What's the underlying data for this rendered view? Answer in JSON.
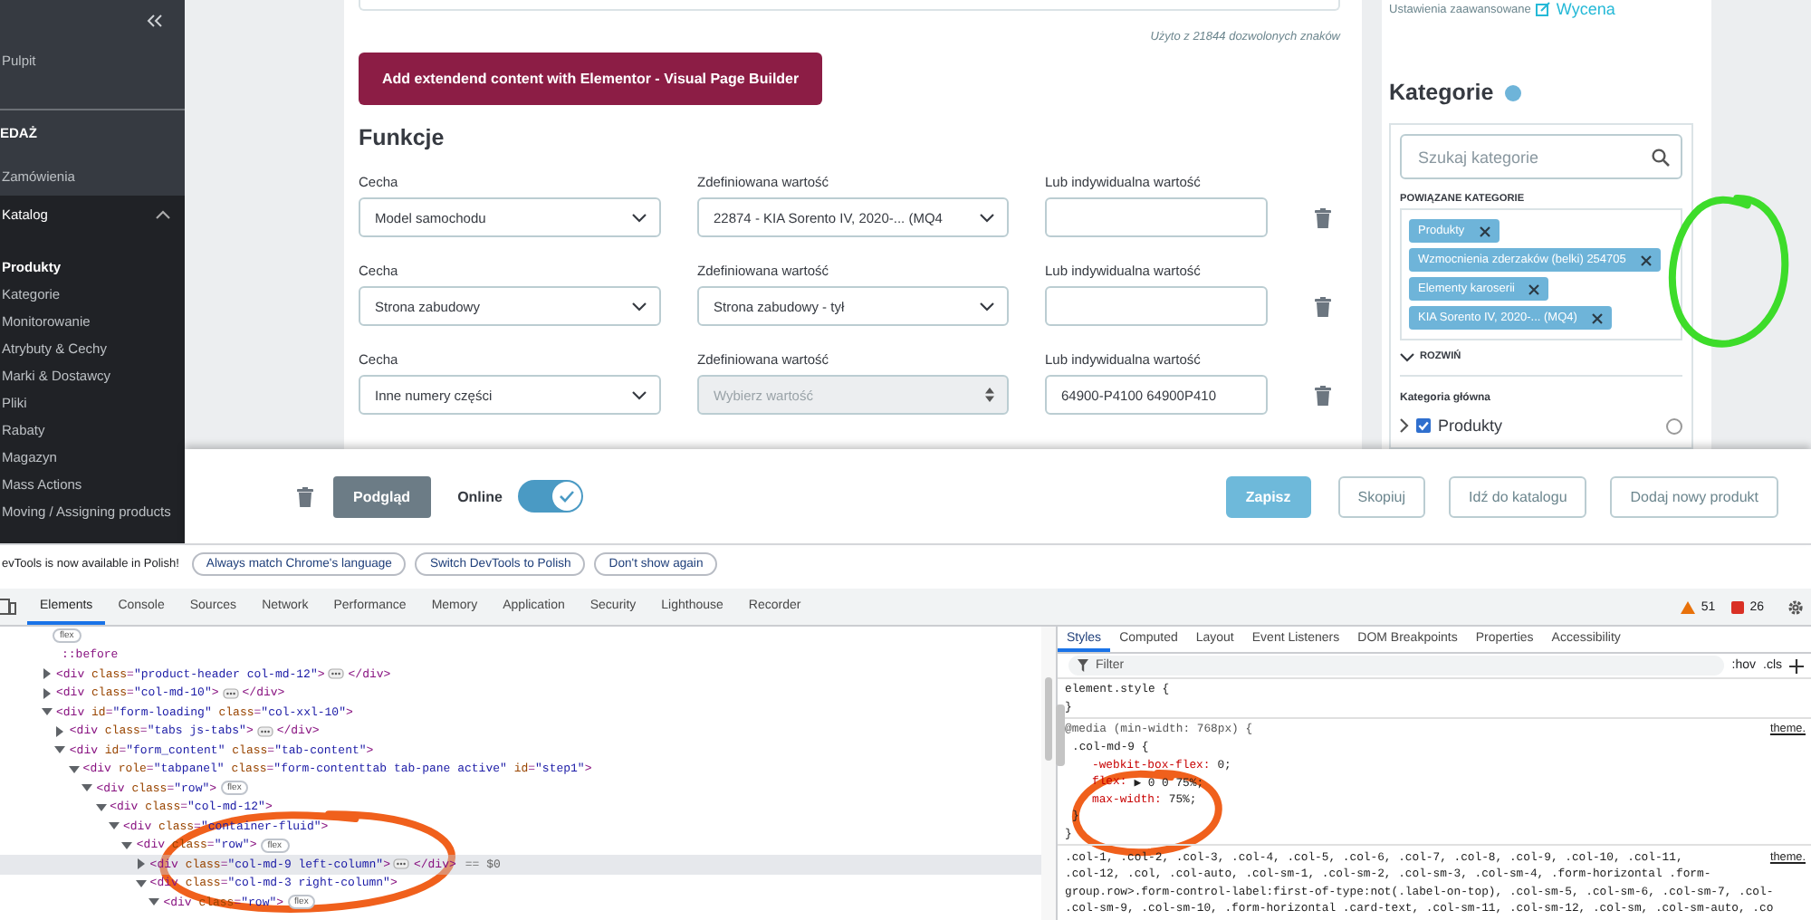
{
  "sidebar": {
    "items": [
      {
        "kind": "link",
        "label": "Pulpit"
      },
      {
        "kind": "section",
        "label": "EDAŻ"
      },
      {
        "kind": "link",
        "label": "Zamówienia"
      },
      {
        "kind": "group",
        "label": "Katalog",
        "expanded": true,
        "children": [
          {
            "label": "Produkty",
            "selected": true
          },
          {
            "label": "Kategorie",
            "selected": false
          },
          {
            "label": "Monitorowanie",
            "selected": false
          },
          {
            "label": "Atrybuty & Cechy",
            "selected": false
          },
          {
            "label": "Marki & Dostawcy",
            "selected": false
          },
          {
            "label": "Pliki",
            "selected": false
          },
          {
            "label": "Rabaty",
            "selected": false
          },
          {
            "label": "Magazyn",
            "selected": false
          },
          {
            "label": "Mass Actions",
            "selected": false
          },
          {
            "label": "Moving / Assigning products",
            "selected": false
          }
        ]
      }
    ]
  },
  "product_form": {
    "counter": "Użyto z 21844 dozwolonych znaków",
    "elementor_button": "Add extendend content with Elementor - Visual Page Builder",
    "features_title": "Funkcje",
    "features": [
      {
        "feature_label": "Cecha",
        "feature": "Model samochodu",
        "value_label": "Zdefiniowana wartość",
        "value": "22874 - KIA Sorento IV, 2020-... (MQ4",
        "value_disabled": false,
        "custom_label": "Lub indywidualna wartość"
      },
      {
        "feature_label": "Cecha",
        "feature": "Strona zabudowy",
        "value_label": "Zdefiniowana wartość",
        "value": "Strona zabudowy - tył",
        "value_disabled": false,
        "custom_label": "Lub indywidualna wartość"
      },
      {
        "feature_label": "Cecha",
        "feature": "Inne numery części",
        "value_label": "Zdefiniowana wartość",
        "value_placeholder": "Wybierz wartość",
        "value_disabled": true,
        "custom_label": "Lub indywidualna wartość",
        "custom": "64900-P4100 64900P410"
      }
    ]
  },
  "category_panel": {
    "advanced_label": "Ustawienia zaawansowane",
    "pricing_link": "Wycena",
    "title": "Kategorie",
    "search_placeholder": "Szukaj kategorie",
    "related_label": "POWIĄZANE KATEGORIE",
    "tags": [
      "Produkty",
      "Wzmocnienia zderzaków (belki) 254705",
      "Elementy karoserii",
      "KIA Sorento IV, 2020-... (MQ4)"
    ],
    "expand_label": "ROZWIŃ",
    "main_label": "Kategoria główna",
    "tree": [
      {
        "label": "Produkty",
        "expanded": false,
        "checked": true,
        "selected": false
      }
    ]
  },
  "action_bar": {
    "preview": "Podgląd",
    "online_label": "Online",
    "online": true,
    "buttons": [
      {
        "label": "Zapisz",
        "kind": "primary"
      },
      {
        "label": "Skopiuj",
        "kind": "outline"
      },
      {
        "label": "Idź do katalogu",
        "kind": "outline"
      },
      {
        "label": "Dodaj nowy produkt",
        "kind": "outline"
      }
    ]
  },
  "devtools": {
    "infobar": {
      "message": "evTools is now available in Polish!",
      "buttons": [
        "Always match Chrome's language",
        "Switch DevTools to Polish",
        "Don't show again"
      ]
    },
    "tabs": [
      {
        "label": "Elements",
        "selected": true
      },
      {
        "label": "Console",
        "selected": false
      },
      {
        "label": "Sources",
        "selected": false
      },
      {
        "label": "Network",
        "selected": false
      },
      {
        "label": "Performance",
        "selected": false
      },
      {
        "label": "Memory",
        "selected": false
      },
      {
        "label": "Application",
        "selected": false
      },
      {
        "label": "Security",
        "selected": false
      },
      {
        "label": "Lighthouse",
        "selected": false
      },
      {
        "label": "Recorder",
        "selected": false
      }
    ],
    "warnings": "51",
    "errors": "26",
    "dom": [
      {
        "kind": "badge",
        "badge": "flex"
      },
      {
        "kind": "pseudo",
        "tag": "::before"
      },
      {
        "kind": "element",
        "tag": "<div class=\"product-header col-md-12\">",
        "tail": "</div>",
        "expanded": false,
        "selected": false
      },
      {
        "kind": "element",
        "tag": "<div class=\"col-md-10\">",
        "tail": "</div>",
        "expanded": false,
        "selected": false
      },
      {
        "kind": "element",
        "tag": "<div id=\"form-loading\" class=\"col-xxl-10\">",
        "expanded": true,
        "selected": false,
        "children": [
          {
            "kind": "element",
            "tag": "<div class=\"tabs js-tabs\">",
            "tail": "</div>",
            "expanded": false,
            "selected": false
          },
          {
            "kind": "element",
            "tag": "<div id=\"form_content\" class=\"tab-content\">",
            "expanded": true,
            "selected": false,
            "children": [
              {
                "kind": "element",
                "tag": "<div role=\"tabpanel\" class=\"form-contenttab tab-pane active\" id=\"step1\">",
                "expanded": true,
                "selected": false,
                "children": [
                  {
                    "kind": "element",
                    "tag": "<div class=\"row\">",
                    "badge": "flex",
                    "expanded": true,
                    "selected": false,
                    "children": [
                      {
                        "kind": "element",
                        "tag": "<div class=\"col-md-12\">",
                        "expanded": true,
                        "selected": false,
                        "children": [
                          {
                            "kind": "element",
                            "tag": "<div class=\"container-fluid\">",
                            "expanded": true,
                            "selected": false,
                            "children": [
                              {
                                "kind": "element",
                                "tag": "<div class=\"row\">",
                                "badge": "flex",
                                "expanded": true,
                                "selected": false,
                                "children": [
                                  {
                                    "kind": "element",
                                    "tag": "<div class=\"col-md-9 left-column\">",
                                    "tail": "</div>",
                                    "console_ref": "== $0",
                                    "expanded": false,
                                    "selected": true
                                  },
                                  {
                                    "kind": "element",
                                    "tag": "<div class=\"col-md-3 right-column\">",
                                    "expanded": true,
                                    "selected": false,
                                    "children": [
                                      {
                                        "kind": "element",
                                        "tag": "<div class=\"row\">",
                                        "badge": "flex",
                                        "expanded": true,
                                        "selected": false
                                      }
                                    ]
                                  }
                                ]
                              }
                            ]
                          }
                        ]
                      }
                    ]
                  }
                ]
              }
            ]
          }
        ]
      }
    ],
    "styles": {
      "tabs": [
        {
          "label": "Styles",
          "selected": true
        },
        {
          "label": "Computed",
          "selected": false
        },
        {
          "label": "Layout",
          "selected": false
        },
        {
          "label": "Event Listeners",
          "selected": false
        },
        {
          "label": "DOM Breakpoints",
          "selected": false
        },
        {
          "label": "Properties",
          "selected": false
        },
        {
          "label": "Accessibility",
          "selected": false
        }
      ],
      "filter_placeholder": "Filter",
      "hov": ":hov",
      "cls": ".cls",
      "rules": [
        {
          "lines": [
            {
              "kind": "line",
              "text": "element.style {"
            },
            {
              "kind": "line",
              "text": "}"
            }
          ]
        },
        {
          "source": "theme.",
          "lines": [
            {
              "kind": "media",
              "text": "@media (min-width: 768px) {"
            },
            {
              "kind": "inner",
              "text": ".col-md-9 {"
            },
            {
              "kind": "prop",
              "name": "-webkit-box-flex:",
              "value": "0;"
            },
            {
              "kind": "prop",
              "name": "flex:",
              "value": "▶ 0 0 75%;"
            },
            {
              "kind": "prop",
              "name": "max-width:",
              "value": "75%;"
            },
            {
              "kind": "inner",
              "text": "}"
            },
            {
              "kind": "line",
              "text": "}"
            }
          ]
        },
        {
          "source": "theme.",
          "lines": [
            {
              "kind": "line",
              "text": ".col-1, .col-2, .col-3, .col-4, .col-5, .col-6, .col-7, .col-8, .col-9, .col-10, .col-11,"
            },
            {
              "kind": "line",
              "text": ".col-12, .col, .col-auto, .col-sm-1, .col-sm-2, .col-sm-3, .col-sm-4, .form-horizontal .form-"
            },
            {
              "kind": "line",
              "text": "group.row>.form-control-label:first-of-type:not(.label-on-top), .col-sm-5, .col-sm-6, .col-sm-7, .col-"
            },
            {
              "kind": "line",
              "text": ".col-sm-9, .col-sm-10, .form-horizontal .card-text, .col-sm-11, .col-sm-12, .col-sm, .col-sm-auto, .co"
            }
          ]
        }
      ]
    }
  },
  "annotations": [
    {
      "color": "#3ddc2a"
    },
    {
      "color": "#f0601c"
    },
    {
      "color": "#f0601c"
    }
  ]
}
